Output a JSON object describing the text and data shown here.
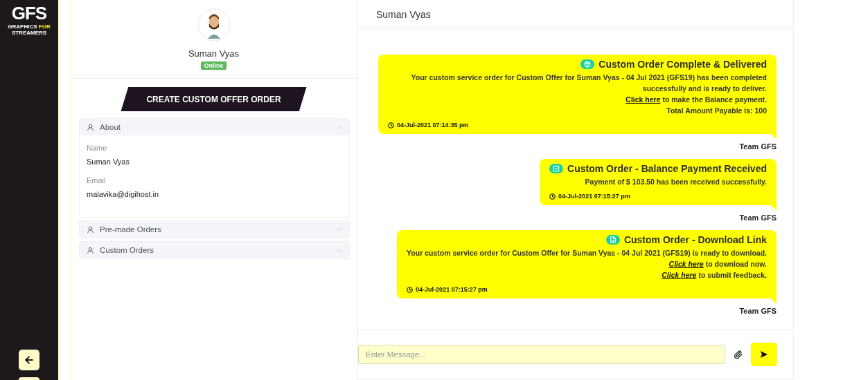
{
  "sidebar": {
    "logo": {
      "letters": "GFS",
      "tagline_start": "GRAPHICS ",
      "tagline_highlight": "FOR",
      "tagline_end": " STREAMERS"
    }
  },
  "profile": {
    "name": "Suman Vyas",
    "status": "Online",
    "online": true
  },
  "create_button": "CREATE CUSTOM OFFER ORDER",
  "accordion": [
    {
      "title": "About",
      "expanded": true,
      "fields": [
        {
          "label": "Name",
          "value": "Suman Vyas"
        },
        {
          "label": "Email",
          "value": "malavika@digihost.in"
        }
      ]
    },
    {
      "title": "Pre-made Orders",
      "expanded": false
    },
    {
      "title": "Custom Orders",
      "expanded": false
    }
  ],
  "chat": {
    "title": "Suman Vyas",
    "messages": [
      {
        "kind": "box",
        "title": "Custom Order Complete & Delivered",
        "lines": [
          {
            "text": "Your custom service order for Custom Offer for Suman Vyas - 04 Jul 2021 (GFS19) has been completed successfully and is ready to deliver."
          },
          {
            "link": "Click here",
            "italic": false,
            "text": " to make the Balance payment."
          },
          {
            "text": "Total Amount Payable is: 100"
          }
        ],
        "time": "04-Jul-2021 07:14:35 pm",
        "sender": "Team GFS"
      },
      {
        "kind": "check",
        "title": "Custom Order - Balance Payment Received",
        "lines": [
          {
            "text": "Payment of $ 103.50 has been received successfully."
          }
        ],
        "time": "04-Jul-2021 07:15:27 pm",
        "sender": "Team GFS"
      },
      {
        "kind": "download",
        "title": "Custom Order - Download Link",
        "lines": [
          {
            "text": "Your custom service order for Custom Offer for Suman Vyas - 04 Jul 2021 (GFS19) is ready to download."
          },
          {
            "link": "Click here",
            "italic": true,
            "text": " to download now."
          },
          {
            "link": "Click here",
            "italic": true,
            "text": " to submit feedback."
          }
        ],
        "time": "04-Jul-2021 07:15:27 pm",
        "sender": "Team GFS"
      }
    ],
    "input": {
      "placeholder": "Enter Message..."
    }
  }
}
